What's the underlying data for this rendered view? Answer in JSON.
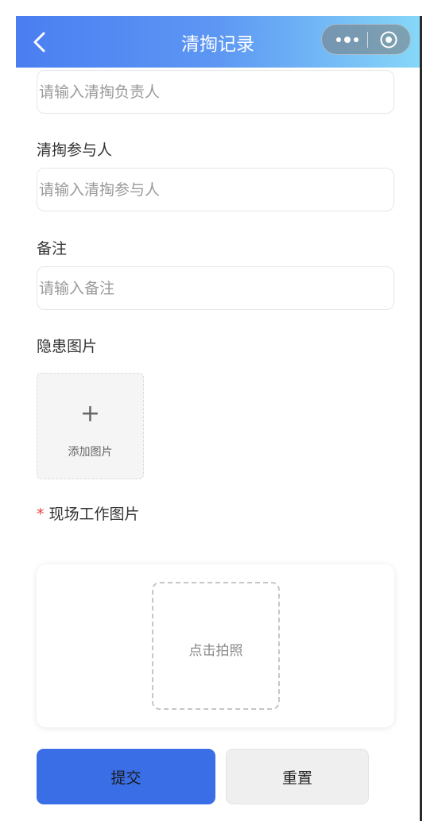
{
  "nav": {
    "title": "清掏记录"
  },
  "form": {
    "responsible_placeholder": "请输入清掏负责人",
    "participants_label": "清掏参与人",
    "participants_placeholder": "请输入清掏参与人",
    "remark_label": "备注",
    "remark_placeholder": "请输入备注",
    "hazard_images_label": "隐患图片",
    "add_image_plus": "+",
    "add_image_label": "添加图片",
    "required_mark": "*",
    "site_images_label": "现场工作图片",
    "take_photo_label": "点击拍照"
  },
  "actions": {
    "submit_label": "提交",
    "reset_label": "重置"
  },
  "colors": {
    "header_start": "#4a7ef1",
    "header_end": "#86d7f8",
    "submit_bg": "#3a6ee6",
    "required": "#ee3b3b"
  }
}
